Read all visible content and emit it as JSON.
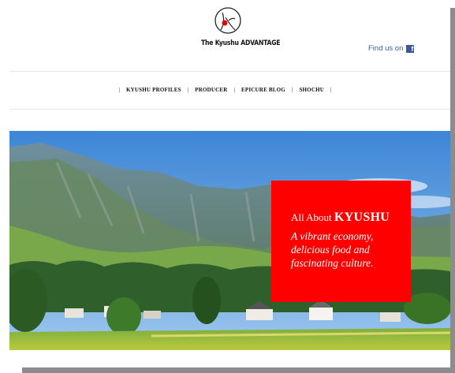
{
  "header": {
    "logo_text": "The Kyushu ADVANTAGE",
    "find_us_label": "Find us on",
    "facebook_glyph": "f"
  },
  "nav": {
    "separator": "|",
    "items": [
      {
        "label": "KYUSHU PROFILES"
      },
      {
        "label": "PRODUCER"
      },
      {
        "label": "EPICURE BLOG"
      },
      {
        "label": "SHOCHU"
      }
    ]
  },
  "hero": {
    "image": "mountain-village-landscape",
    "promo": {
      "title_prefix": "All About",
      "title_emphasis": "KYUSHU",
      "subtitle": "A vibrant economy, delicious food and fascinating culture."
    }
  },
  "colors": {
    "promo_background": "#ff0000",
    "link_blue": "#3b5b9c",
    "facebook_blue": "#3b5998",
    "shadow_grey": "#8c8c8c"
  }
}
